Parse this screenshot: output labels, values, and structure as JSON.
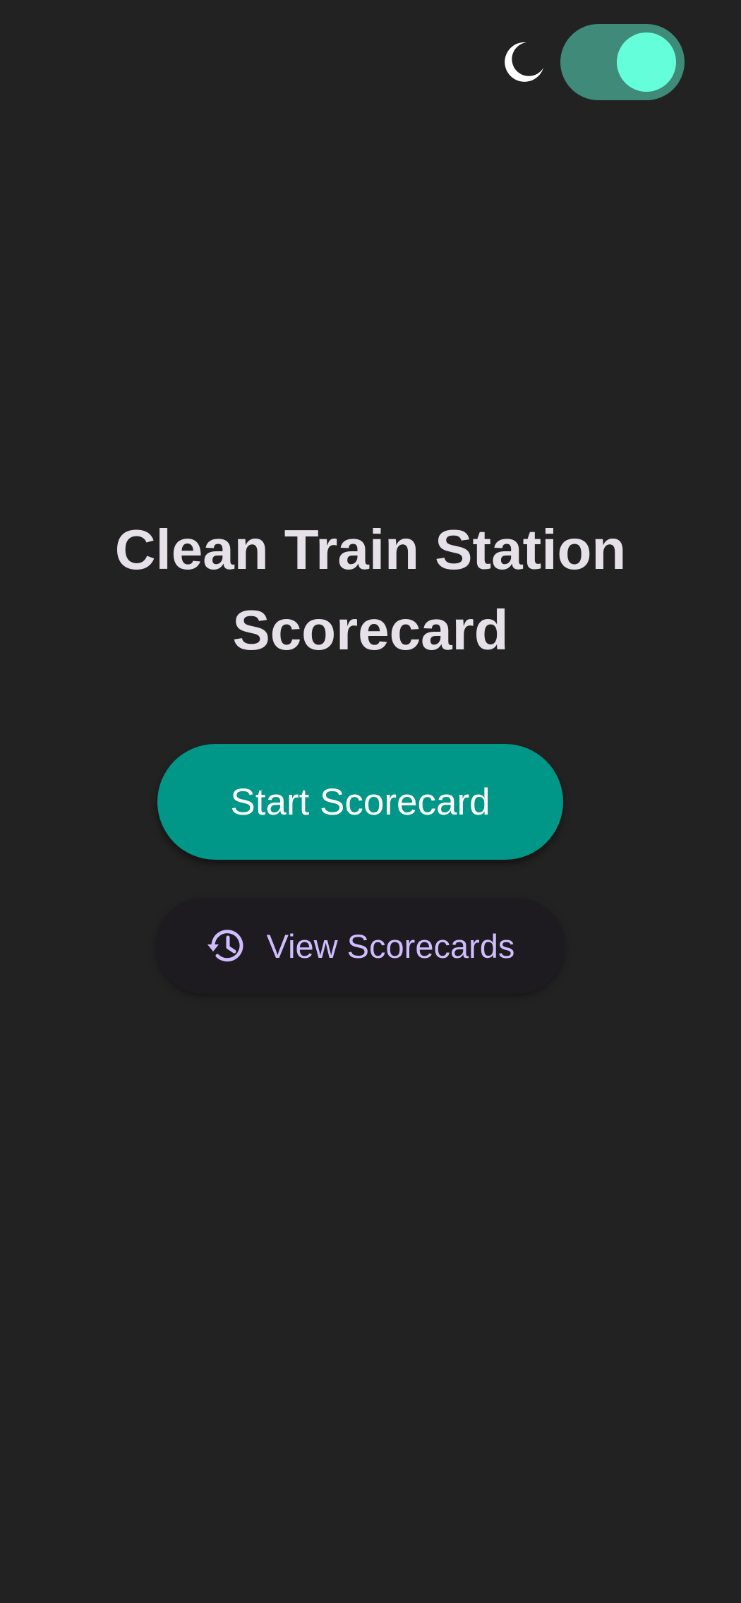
{
  "colors": {
    "background": "#222222",
    "title_text": "#e6e0e9",
    "primary_button": "#009688",
    "primary_button_text": "#ffffff",
    "secondary_button": "#1d1b20",
    "secondary_accent": "#d0bcff",
    "switch_track": "#3f8a78",
    "switch_thumb": "#64ffda"
  },
  "theme_toggle": {
    "icon": "moon-icon",
    "state": "on"
  },
  "title": {
    "line1": "Clean Train Station",
    "line2": "Scorecard"
  },
  "actions": {
    "start_label": "Start Scorecard",
    "view_label": "View Scorecards",
    "view_icon": "history-icon"
  }
}
